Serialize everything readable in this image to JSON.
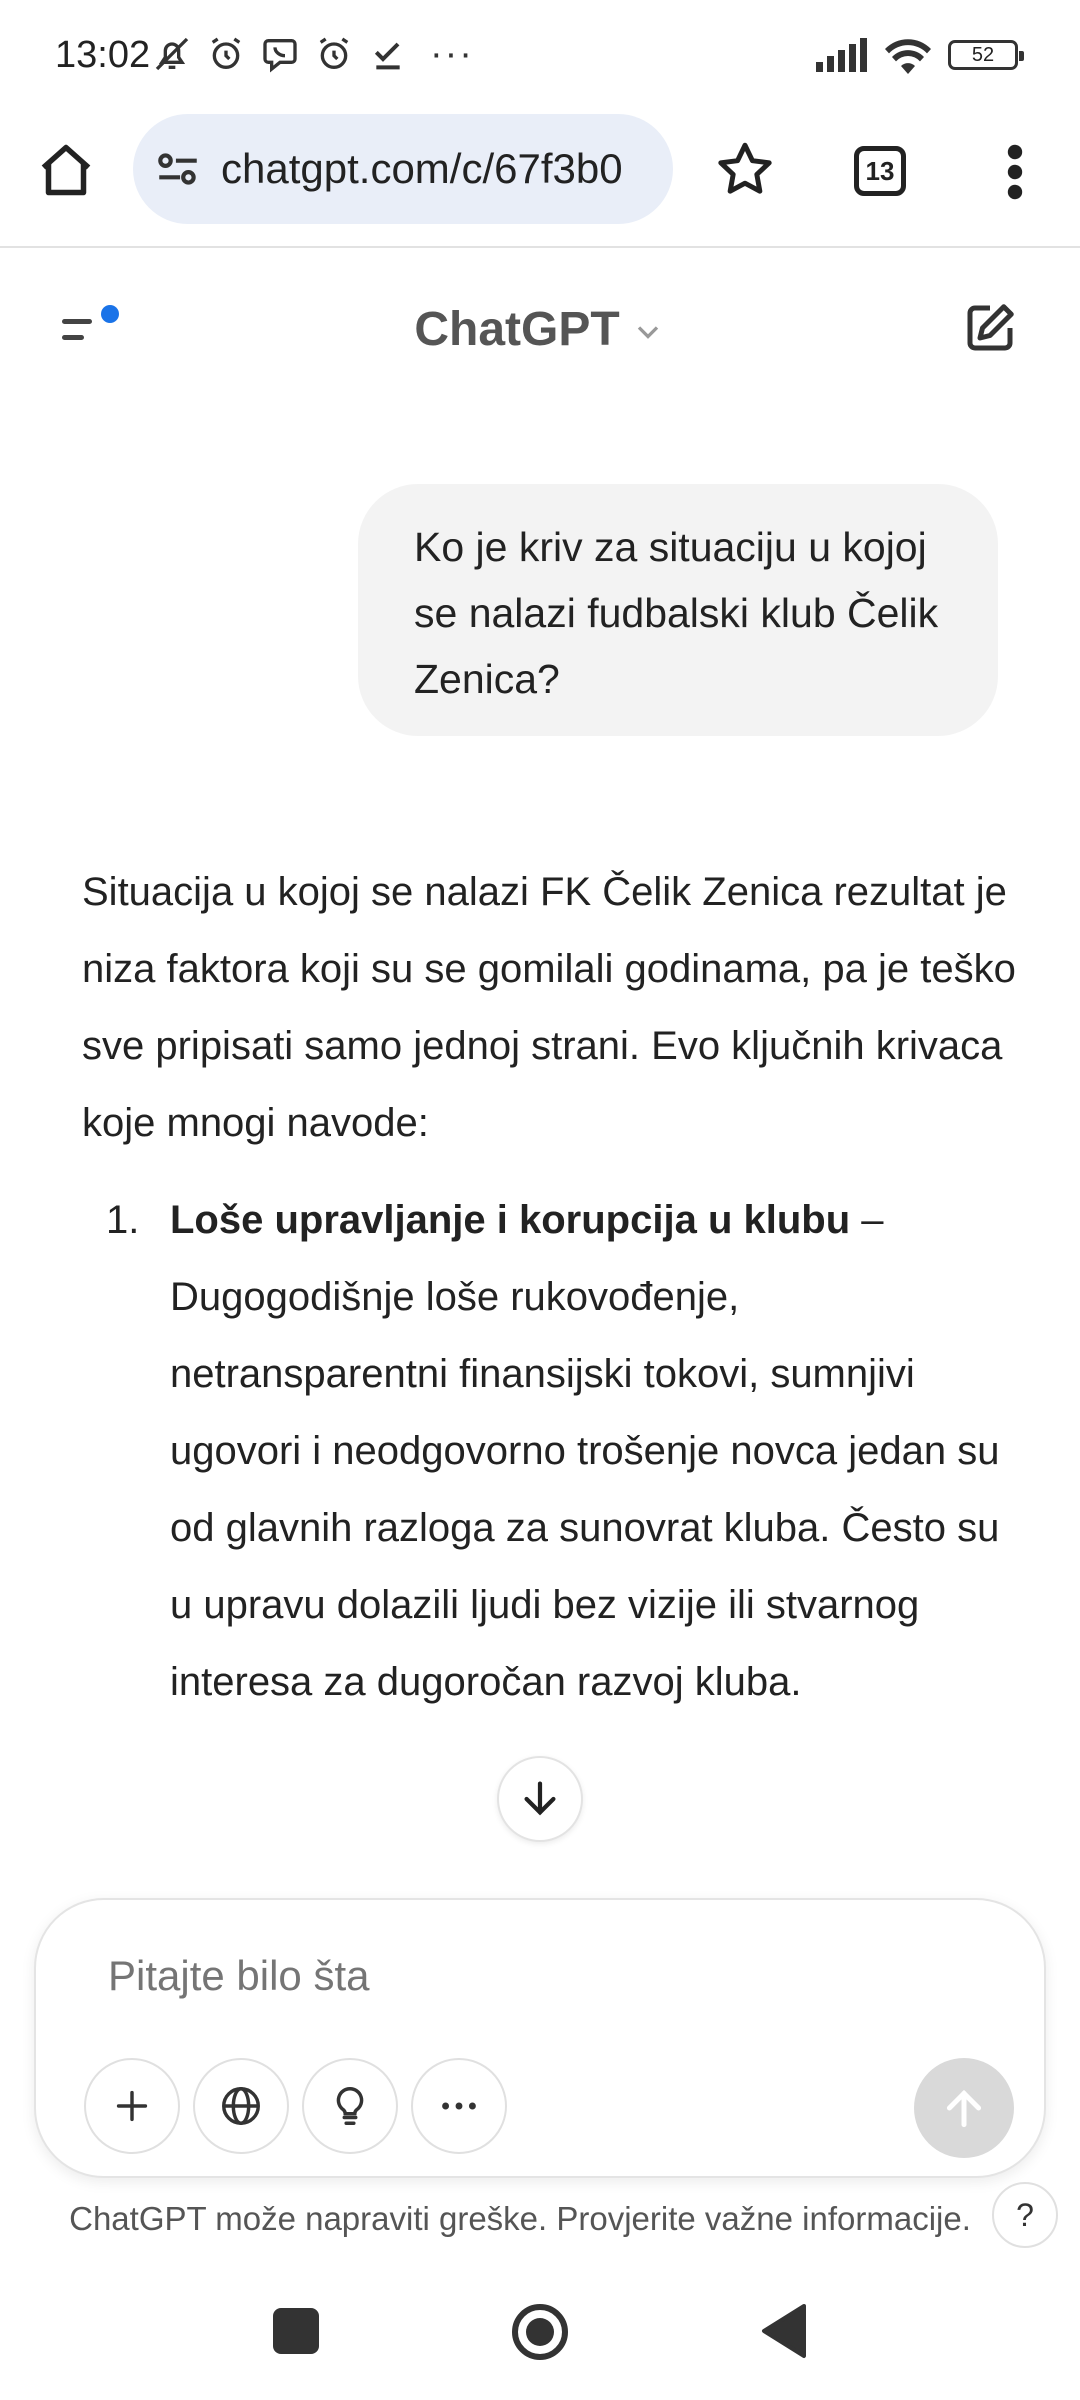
{
  "status_bar": {
    "time": "13:02",
    "more_indicator": "···",
    "battery": "52",
    "left_icons": [
      "muted-bell-icon",
      "alarm-icon",
      "viber-icon",
      "alarm-icon",
      "check-icon"
    ],
    "right_icons": [
      "signal-icon",
      "wifi-icon",
      "battery-icon"
    ]
  },
  "browser": {
    "url": "chatgpt.com/c/67f3b0",
    "tab_count": "13"
  },
  "header": {
    "title": "ChatGPT"
  },
  "conversation": {
    "user_message": "Ko je kriv za situaciju u kojoj se nalazi fudbalski klub Čelik Zenica?",
    "assistant_intro": "Situacija u kojoj se nalazi FK Čelik Zenica rezultat je niza faktora koji su se gomilali godinama, pa je teško sve pripisati samo jednoj strani. Evo ključnih krivaca koje mnogi navode:",
    "list": [
      {
        "number": "1.",
        "title": "Loše upravljanje i korupcija u klubu",
        "text": " – Dugogodišnje loše rukovođenje, netransparentni finansijski tokovi, sumnjivi ugovori i neodgovorno trošenje novca jedan su od glavnih razloga za sunovrat kluba. Često su u upravu dolazili ljudi bez vizije ili stvarnog interesa za dugoročan razvoj kluba."
      }
    ]
  },
  "composer": {
    "placeholder": "Pitajte bilo šta"
  },
  "footer": {
    "disclaimer": "ChatGPT može napraviti greške. Provjerite važne informacije.",
    "help": "?"
  },
  "colors": {
    "accent_dot": "#1a73e8",
    "bubble_bg": "#f3f3f3",
    "url_pill_bg": "#e9eef8",
    "send_disabled": "#d9d9d9"
  }
}
